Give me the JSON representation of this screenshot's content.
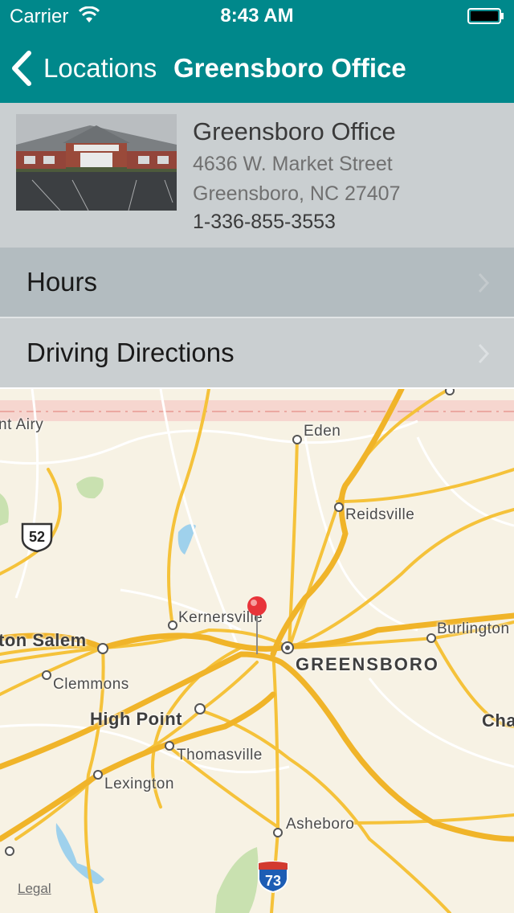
{
  "status_bar": {
    "carrier": "Carrier",
    "time": "8:43 AM"
  },
  "nav": {
    "back_label": "Locations",
    "title": "Greensboro Office"
  },
  "office": {
    "name": "Greensboro Office",
    "address_line1": "4636 W. Market Street",
    "address_line2": "Greensboro, NC 27407",
    "phone": "1-336-855-3553"
  },
  "menu": {
    "hours_label": "Hours",
    "directions_label": "Driving Directions"
  },
  "map": {
    "cities": {
      "mount_airy": "nt Airy",
      "eden": "Eden",
      "reidsville": "Reidsville",
      "kernersville": "Kernersville",
      "burlington": "Burlington",
      "winston_salem": "ton Salem",
      "greensboro": "GREENSBORO",
      "clemmons": "Clemmons",
      "high_point": "High Point",
      "thomasville": "Thomasville",
      "lexington": "Lexington",
      "asheboro": "Asheboro",
      "chapel_hill": "Cha"
    },
    "shields": {
      "us52": "52",
      "i73": "73"
    },
    "legal_label": "Legal"
  },
  "colors": {
    "bar": "#00888b",
    "road": "#f5c23a",
    "pin": "#e8343a"
  }
}
